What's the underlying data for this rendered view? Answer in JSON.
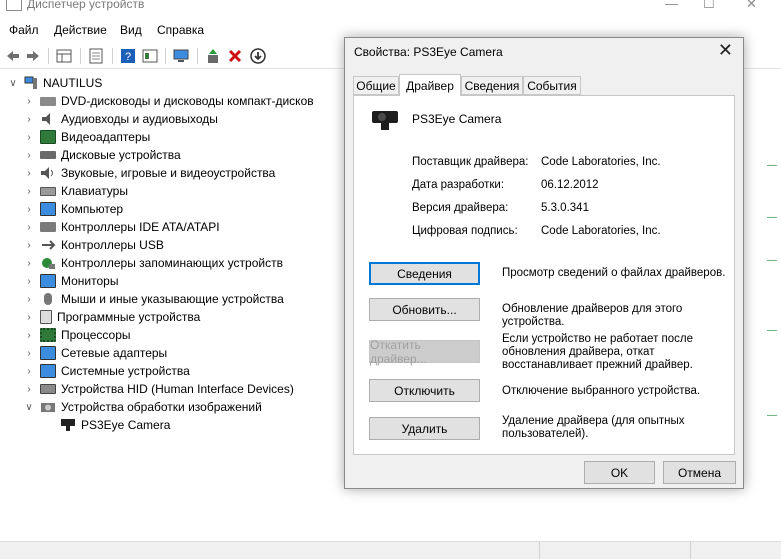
{
  "window": {
    "title": "Диспетчер устройств"
  },
  "menu": [
    "Файл",
    "Действие",
    "Вид",
    "Справка"
  ],
  "tree": {
    "root": "NAUTILUS",
    "categories": [
      "DVD-дисководы и дисководы компакт-дисков",
      "Аудиовходы и аудиовыходы",
      "Видеоадаптеры",
      "Дисковые устройства",
      "Звуковые, игровые и видеоустройства",
      "Клавиатуры",
      "Компьютер",
      "Контроллеры IDE ATA/ATAPI",
      "Контроллеры USB",
      "Контроллеры запоминающих устройств",
      "Мониторы",
      "Мыши и иные указывающие устройства",
      "Программные устройства",
      "Процессоры",
      "Сетевые адаптеры",
      "Системные устройства",
      "Устройства HID (Human Interface Devices)",
      "Устройства обработки изображений"
    ],
    "child": "PS3Eye Camera"
  },
  "dialog": {
    "title": "Свойства: PS3Eye Camera",
    "tabs": [
      "Общие",
      "Драйвер",
      "Сведения",
      "События"
    ],
    "device_name": "PS3Eye Camera",
    "props": {
      "provider_label": "Поставщик драйвера:",
      "provider_value": "Code Laboratories, Inc.",
      "date_label": "Дата разработки:",
      "date_value": "06.12.2012",
      "version_label": "Версия драйвера:",
      "version_value": "5.3.0.341",
      "signer_label": "Цифровая подпись:",
      "signer_value": "Code Laboratories, Inc."
    },
    "buttons": {
      "details": "Сведения",
      "details_desc": "Просмотр сведений о файлах драйверов.",
      "update": "Обновить...",
      "update_desc": "Обновление драйверов для этого устройства.",
      "rollback": "Откатить драйвер...",
      "rollback_desc": "Если устройство не работает после обновления драйвера, откат восстанавливает прежний драйвер.",
      "disable": "Отключить",
      "disable_desc": "Отключение выбранного устройства.",
      "uninstall": "Удалить",
      "uninstall_desc": "Удаление драйвера (для опытных пользователей).",
      "ok": "OK",
      "cancel": "Отмена"
    }
  },
  "colors": {
    "accent": "#0078d7",
    "delete_red": "#d01010",
    "green": "#2a8a3a"
  }
}
